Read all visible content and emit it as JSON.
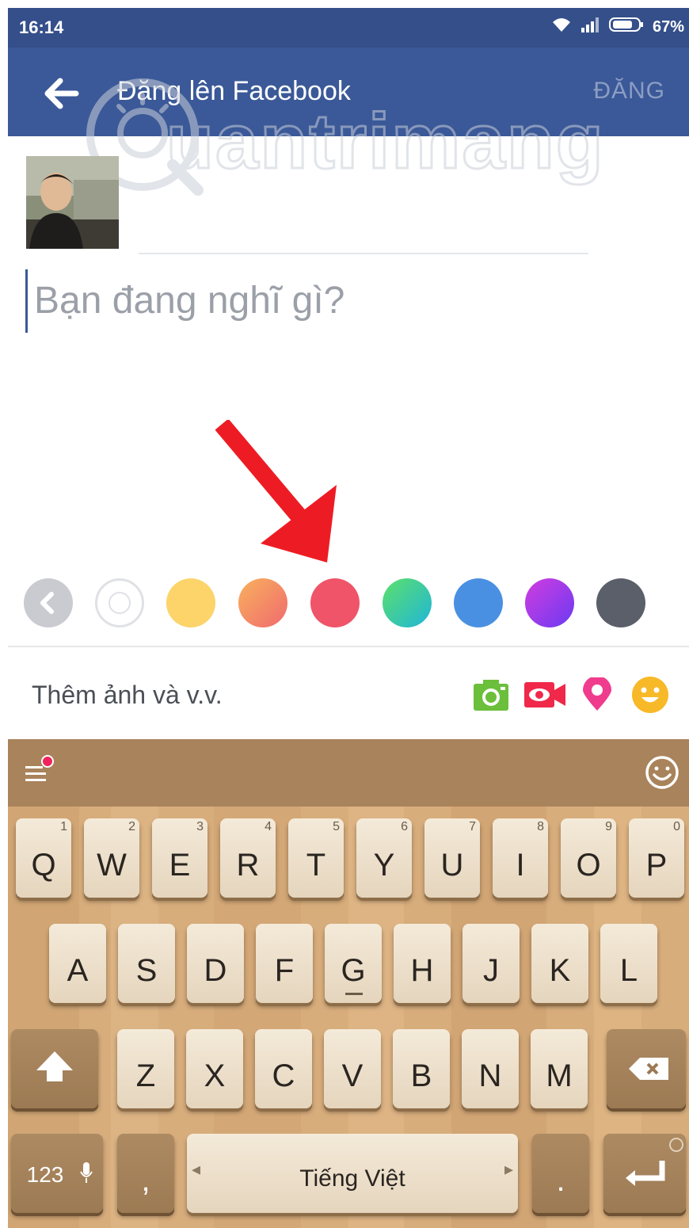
{
  "status_bar": {
    "time": "16:14",
    "battery": "67%",
    "icons": [
      "wifi-icon",
      "signal-icon",
      "battery-icon"
    ]
  },
  "app_bar": {
    "title": "Đăng lên Facebook",
    "post_label": "ĐĂNG",
    "back_icon": "arrow-left-icon",
    "bg_color": "#3b5998"
  },
  "watermark": {
    "text": "uantrimang"
  },
  "composer": {
    "placeholder": "Bạn đang nghĩ gì?"
  },
  "color_picker": {
    "collapse_icon": "chevron-left-icon",
    "swatches": [
      {
        "name": "white",
        "color": "#ffffff"
      },
      {
        "name": "yellow",
        "color": "#fcd46a"
      },
      {
        "name": "orange-gradient",
        "color": "#f4845f"
      },
      {
        "name": "red",
        "color": "#ef5469"
      },
      {
        "name": "teal-gradient",
        "color": "#2fc8a6"
      },
      {
        "name": "blue",
        "color": "#4a90e2"
      },
      {
        "name": "purple-gradient",
        "color": "#a33df0"
      },
      {
        "name": "dark-gray",
        "color": "#5a5f69"
      }
    ]
  },
  "add_bar": {
    "label": "Thêm ảnh và v.v.",
    "icons": [
      "camera-icon",
      "video-icon",
      "location-pin-icon",
      "smiley-icon"
    ]
  },
  "keyboard": {
    "row1": [
      {
        "key": "Q",
        "sub": "1"
      },
      {
        "key": "W",
        "sub": "2"
      },
      {
        "key": "E",
        "sub": "3"
      },
      {
        "key": "R",
        "sub": "4"
      },
      {
        "key": "T",
        "sub": "5"
      },
      {
        "key": "Y",
        "sub": "6"
      },
      {
        "key": "U",
        "sub": "7"
      },
      {
        "key": "I",
        "sub": "8"
      },
      {
        "key": "O",
        "sub": "9"
      },
      {
        "key": "P",
        "sub": "0"
      }
    ],
    "row2": [
      "A",
      "S",
      "D",
      "F",
      "G",
      "H",
      "J",
      "K",
      "L"
    ],
    "row3": [
      "Z",
      "X",
      "C",
      "V",
      "B",
      "N",
      "M"
    ],
    "num_label": "123",
    "comma": ",",
    "space_label": "Tiếng Việt",
    "period": ".",
    "shift_icon": "shift-icon",
    "backspace_icon": "backspace-icon",
    "enter_icon": "enter-icon",
    "mic_icon": "microphone-icon"
  }
}
